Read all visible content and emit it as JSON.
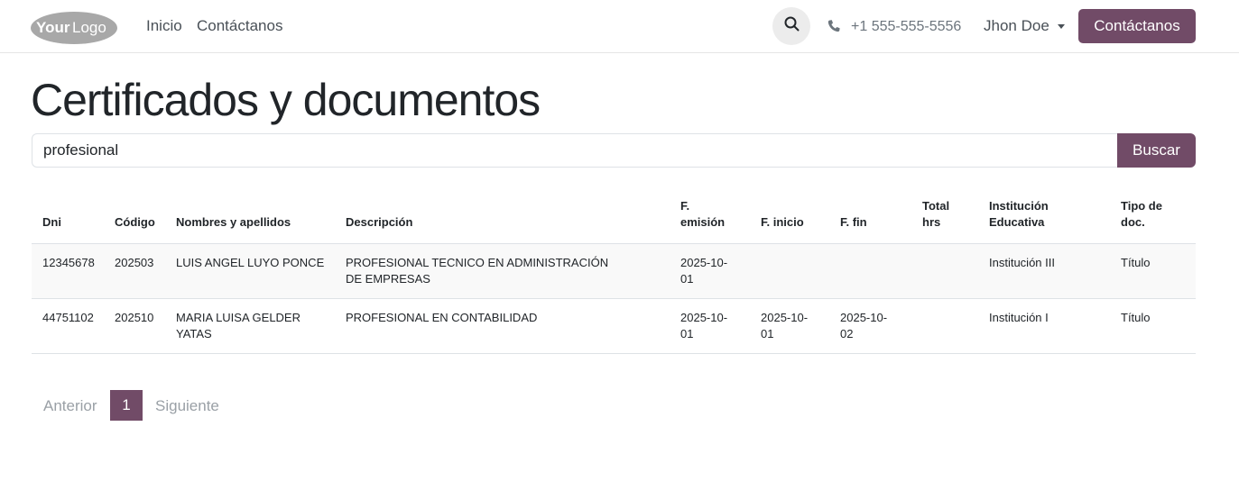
{
  "header": {
    "logo_text": "YourLogo",
    "nav": [
      {
        "label": "Inicio"
      },
      {
        "label": "Contáctanos"
      }
    ],
    "search_icon": "search-icon",
    "phone_icon": "phone-icon",
    "phone": "+1 555-555-5556",
    "user": "Jhon Doe",
    "cta_label": "Contáctanos",
    "accent_color": "#714b67"
  },
  "page": {
    "title": "Certificados y documentos"
  },
  "search": {
    "value": "profesional",
    "button_label": "Buscar"
  },
  "table": {
    "columns": [
      "Dni",
      "Código",
      "Nombres y apellidos",
      "Descripción",
      "F. emisión",
      "F. inicio",
      "F. fin",
      "Total hrs",
      "Institución Educativa",
      "Tipo de doc."
    ],
    "rows": [
      [
        "12345678",
        "202503",
        "LUIS ANGEL LUYO PONCE",
        "PROFESIONAL TECNICO EN ADMINISTRACIÓN DE EMPRESAS",
        "2025-10-01",
        "",
        "",
        "",
        "Institución III",
        "Título"
      ],
      [
        "44751102",
        "202510",
        "MARIA LUISA GELDER YATAS",
        "PROFESIONAL EN CONTABILIDAD",
        "2025-10-01",
        "2025-10-01",
        "2025-10-02",
        "",
        "Institución I",
        "Título"
      ]
    ]
  },
  "pagination": {
    "prev": "Anterior",
    "current": "1",
    "next": "Siguiente"
  }
}
